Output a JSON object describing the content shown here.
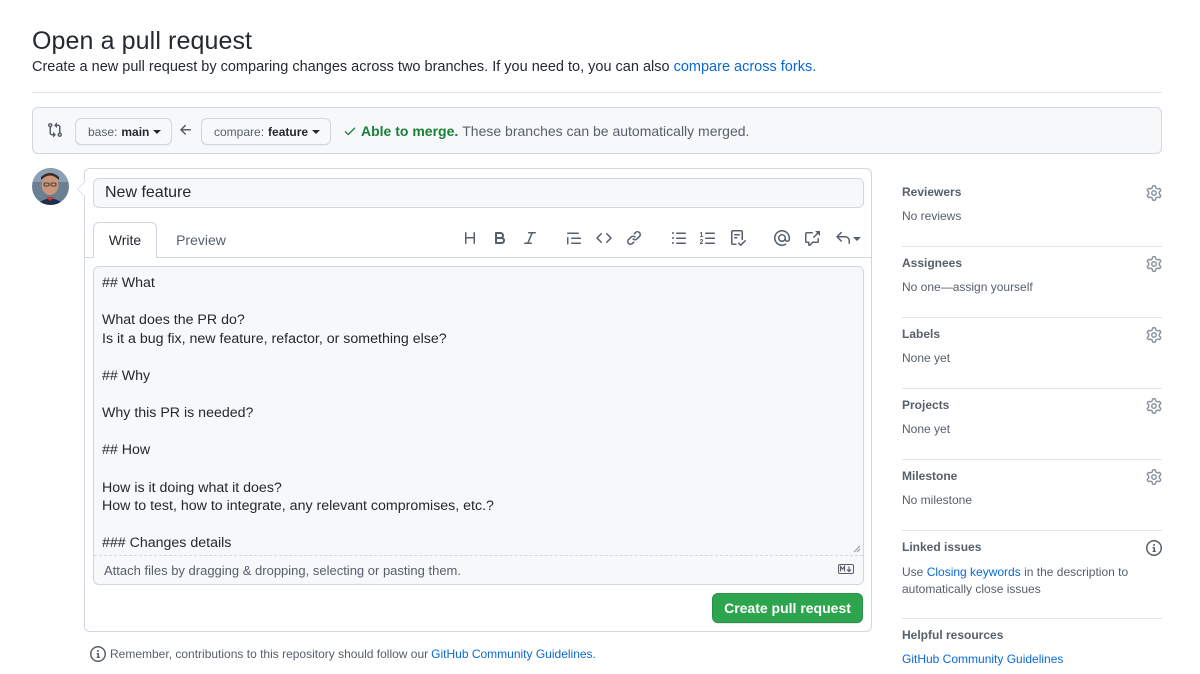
{
  "header": {
    "title": "Open a pull request",
    "subtitle_prefix": "Create a new pull request by comparing changes across two branches. If you need to, you can also",
    "subtitle_link": "compare across forks."
  },
  "compare": {
    "base_label": "base:",
    "base_branch": "main",
    "compare_label": "compare:",
    "compare_branch": "feature",
    "merge_ok": "Able to merge.",
    "merge_message": "These branches can be automatically merged."
  },
  "form": {
    "title_value": "New feature",
    "tab_write": "Write",
    "tab_preview": "Preview",
    "body": "## What\n\nWhat does the PR do?\nIs it a bug fix, new feature, refactor, or something else?\n\n## Why\n\nWhy this PR is needed?\n\n## How\n\nHow is it doing what it does?\nHow to test, how to integrate, any relevant compromises, etc.?\n\n### Changes details",
    "attach_text": "Attach files by dragging & dropping, selecting or pasting them.",
    "submit_label": "Create pull request"
  },
  "toolbar": {
    "icons": [
      "heading-icon",
      "bold-icon",
      "italic-icon",
      "quote-icon",
      "code-icon",
      "link-icon",
      "unordered-list-icon",
      "ordered-list-icon",
      "task-list-icon",
      "mention-icon",
      "cross-reference-icon",
      "reply-icon"
    ]
  },
  "reminder": {
    "prefix": "Remember, contributions to this repository should follow our",
    "link": "GitHub Community Guidelines."
  },
  "sidebar": {
    "reviewers": {
      "heading": "Reviewers",
      "value": "No reviews"
    },
    "assignees": {
      "heading": "Assignees",
      "value": "No one—assign yourself"
    },
    "labels": {
      "heading": "Labels",
      "value": "None yet"
    },
    "projects": {
      "heading": "Projects",
      "value": "None yet"
    },
    "milestone": {
      "heading": "Milestone",
      "value": "No milestone"
    },
    "linked_issues": {
      "heading": "Linked issues",
      "desc_prefix": "Use",
      "desc_link": "Closing keywords",
      "desc_suffix": "in the description to automatically close issues"
    },
    "helpful": {
      "heading": "Helpful resources",
      "link": "GitHub Community Guidelines"
    }
  },
  "colors": {
    "link": "#0969da",
    "success": "#1a7f37",
    "primary_button": "#2da44e",
    "muted_text": "#57606a",
    "border": "#d0d7de"
  }
}
